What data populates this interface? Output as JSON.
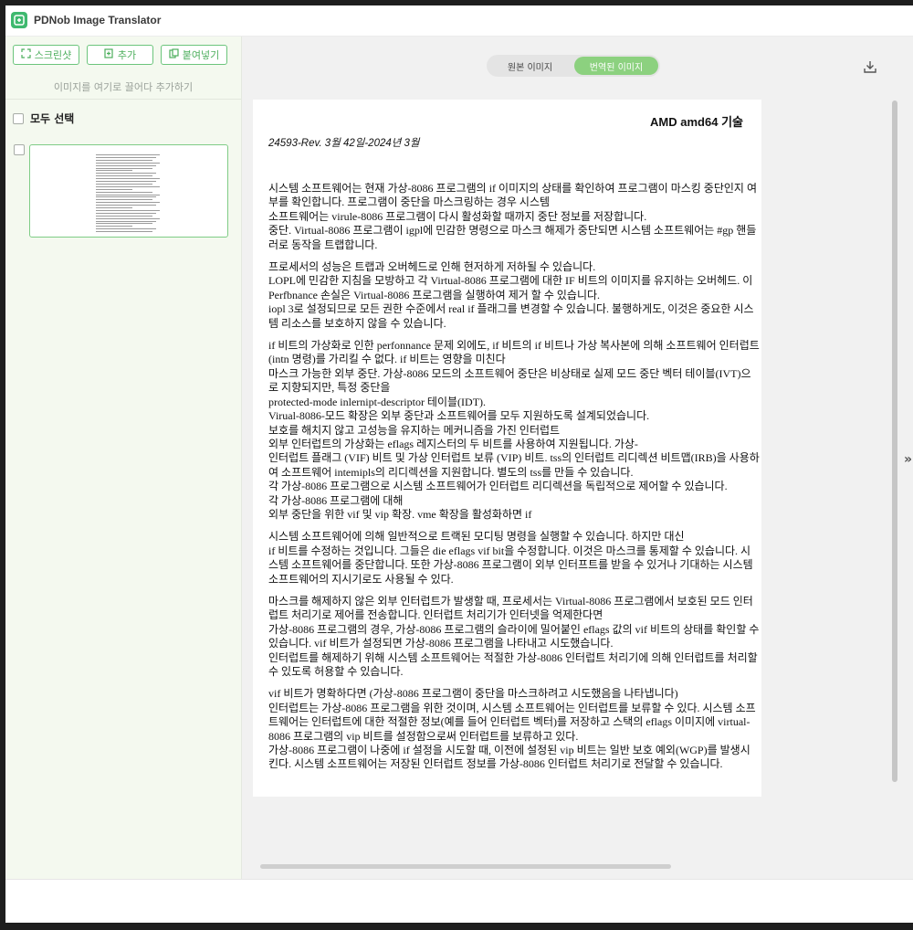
{
  "app": {
    "title": "PDNob Image Translator"
  },
  "sidebar": {
    "buttons": [
      {
        "label": "스크린샷",
        "icon": "screenshot-icon"
      },
      {
        "label": "추가",
        "icon": "add-file-icon"
      },
      {
        "label": "붙여넣기",
        "icon": "paste-icon"
      }
    ],
    "drop_hint": "이미지를 여기로 끌어다 추가하기",
    "select_all_label": "모두 선택",
    "thumbnail_count": 1
  },
  "toolbar": {
    "tab_original": "원본 이미지",
    "tab_translated": "번역된 이미지",
    "active_tab": "translated",
    "download_icon": "download-icon",
    "accent_color": "#8cd17f"
  },
  "document": {
    "header": "AMD amd64 기술",
    "revision": "24593-Rev. 3월 42일-2024년 3월",
    "paragraphs": [
      "시스템 소프트웨어는 현재 가상-8086 프로그램의 if 이미지의 상태를 확인하여 프로그램이 마스킹 중단인지 여부를 확인합니다. 프로그램이 중단을 마스크링하는 경우 시스템\n소프트웨어는 virule-8086 프로그램이 다시 활성화할 때까지 중단 정보를 저장합니다.\n중단. Virtual-8086 프로그램이 igpl에 민감한 명령으로 마스크 해제가 중단되면 시스템 소프트웨어는 #gp 핸들러로 동작을 트랩합니다.",
      "프로세서의 성능은 트랩과 오버헤드로 인해 현저하게 저하될 수 있습니다.\nLOPL에 민감한 지침을 모방하고 각 Virtual-8086 프로그램에 대한 IF 비트의 이미지를 유지하는 오버헤드. 이 Perfbnance 손실은 Virtual-8086 프로그램을 실행하여 제거 할 수 있습니다.\niopl 3로 설정되므로 모든 권한 수준에서 real if 플래그를 변경할 수 있습니다. 불행하게도, 이것은 중요한 시스템 리소스를 보호하지 않을 수 있습니다.",
      "if 비트의 가상화로 인한 perfonnance 문제 외에도, if 비트의 if 비트나 가상 복사본에 의해 소프트웨어 인터럽트(intn 명령)를 가리킬 수 없다. if 비트는 영향을 미친다\n마스크 가능한 외부 중단. 가상-8086 모드의 소프트웨어 중단은 비상태로 실제 모드 중단 벡터 테이블(IVT)으로 지향되지만, 특정 중단을\nprotected-mode inlernipt-descriptor 테이블(IDT).\nVirual-8086-모드 확장은 외부 중단과 소프트웨어를 모두 지원하도록 설계되었습니다.\n보호를 해치지 않고 고성능을 유지하는 메커니즘을 가진 인터럽트\n외부 인터럽트의 가상화는 eflags 레지스터의 두 비트를 사용하여 지원됩니다. 가상-\n인터럽트 플래그 (VIF) 비트 및 가상 인터럽트 보류 (VIP) 비트. tss의 인터럽트 리디렉션 비트맵(IRB)을 사용하여 소프트웨어 intemipls의 리디렉션을 지원합니다. 별도의 tss를 만들 수 있습니다.\n각 가상-8086 프로그램으로 시스템 소프트웨어가 인터럽트 리디렉션을 독립적으로 제어할 수 있습니다.\n각 가상-8086 프로그램에 대해\n외부 중단을 위한 vif 및 vip 확장. vme 확장을 활성화하면 if",
      "시스템 소프트웨어에 의해 일반적으로 트랙된 모디팅 명령을 실행할 수 있습니다. 하지만 대신\nif 비트를 수정하는 것입니다. 그들은 die eflags vif bit을 수정합니다. 이것은 마스크를 통제할 수 있습니다. 시스템 소프트웨어를 중단합니다. 또한 가상-8086 프로그램이 외부 인터프트를 받을 수 있거나 기대하는 시스템 소프트웨어의 지시기로도 사용될 수 있다.",
      "마스크를 해제하지 않은 외부 인터럽트가 발생할 때, 프로세서는 Virtual-8086 프로그램에서 보호된 모드 인터럽트 처리기로 제어를 전송합니다. 인터럽트 처리기가 인터넷을 억제한다면\n가상-8086 프로그램의 경우, 가상-8086 프로그램의 슬라이에 밀어붙인 eflags 값의 vif 비트의 상태를 확인할 수 있습니다. vif 비트가 설정되면 가상-8086 프로그램을 나타내고 시도했습니다.\n인터럽트를 해제하기 위해 시스템 소프트웨어는 적절한 가상-8086 인터럽트 처리기에 의해 인터럽트를 처리할 수 있도록 허용할 수 있습니다.",
      "vif 비트가 명확하다면 (가상-8086 프로그램이 중단을 마스크하려고 시도했음을 나타냅니다)\n인터럽트는 가상-8086 프로그램을 위한 것이며, 시스템 소프트웨어는 인터럽트를 보류할 수 있다. 시스템 소프트웨어는 인터럽트에 대한 적절한 정보(예를 들어 인터럽트 벡터)를 저장하고 스택의 eflags 이미지에 virtual-8086 프로그램의 vip 비트를 설정함으로써 인터럽트를 보류하고 있다.\n가상-8086 프로그램이 나중에 if 설정을 시도할 때, 이전에 설정된 vip 비트는 일반 보호 예외(WGP)를 발생시킨다. 시스템 소프트웨어는 저장된 인터럽트 정보를 가상-8086 인터럽트 처리기로 전달할 수 있습니다."
    ]
  }
}
